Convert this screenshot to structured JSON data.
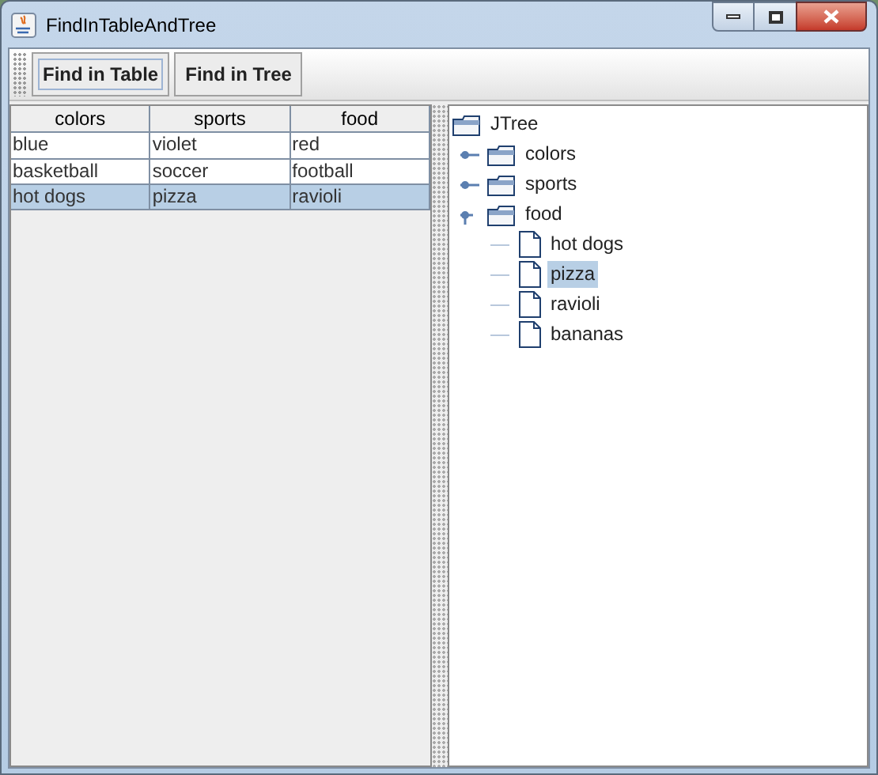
{
  "window": {
    "title": "FindInTableAndTree"
  },
  "toolbar": {
    "buttons": [
      {
        "label": "Find in Table",
        "focused": true
      },
      {
        "label": "Find in Tree",
        "focused": false
      }
    ]
  },
  "table": {
    "columns": [
      "colors",
      "sports",
      "food"
    ],
    "rows": [
      {
        "cells": [
          "blue",
          "violet",
          "red"
        ],
        "selected": false
      },
      {
        "cells": [
          "basketball",
          "soccer",
          "football"
        ],
        "selected": false
      },
      {
        "cells": [
          "hot dogs",
          "pizza",
          "ravioli"
        ],
        "selected": true
      }
    ]
  },
  "tree": {
    "label": "JTree",
    "kind": "folder",
    "selected": false,
    "children": [
      {
        "label": "colors",
        "kind": "folder",
        "expanded": false,
        "selected": false
      },
      {
        "label": "sports",
        "kind": "folder",
        "expanded": false,
        "selected": false
      },
      {
        "label": "food",
        "kind": "folder",
        "expanded": true,
        "selected": false,
        "children": [
          {
            "label": "hot dogs",
            "kind": "leaf",
            "selected": false
          },
          {
            "label": "pizza",
            "kind": "leaf",
            "selected": true
          },
          {
            "label": "ravioli",
            "kind": "leaf",
            "selected": false
          },
          {
            "label": "bananas",
            "kind": "leaf",
            "selected": false
          }
        ]
      }
    ]
  }
}
